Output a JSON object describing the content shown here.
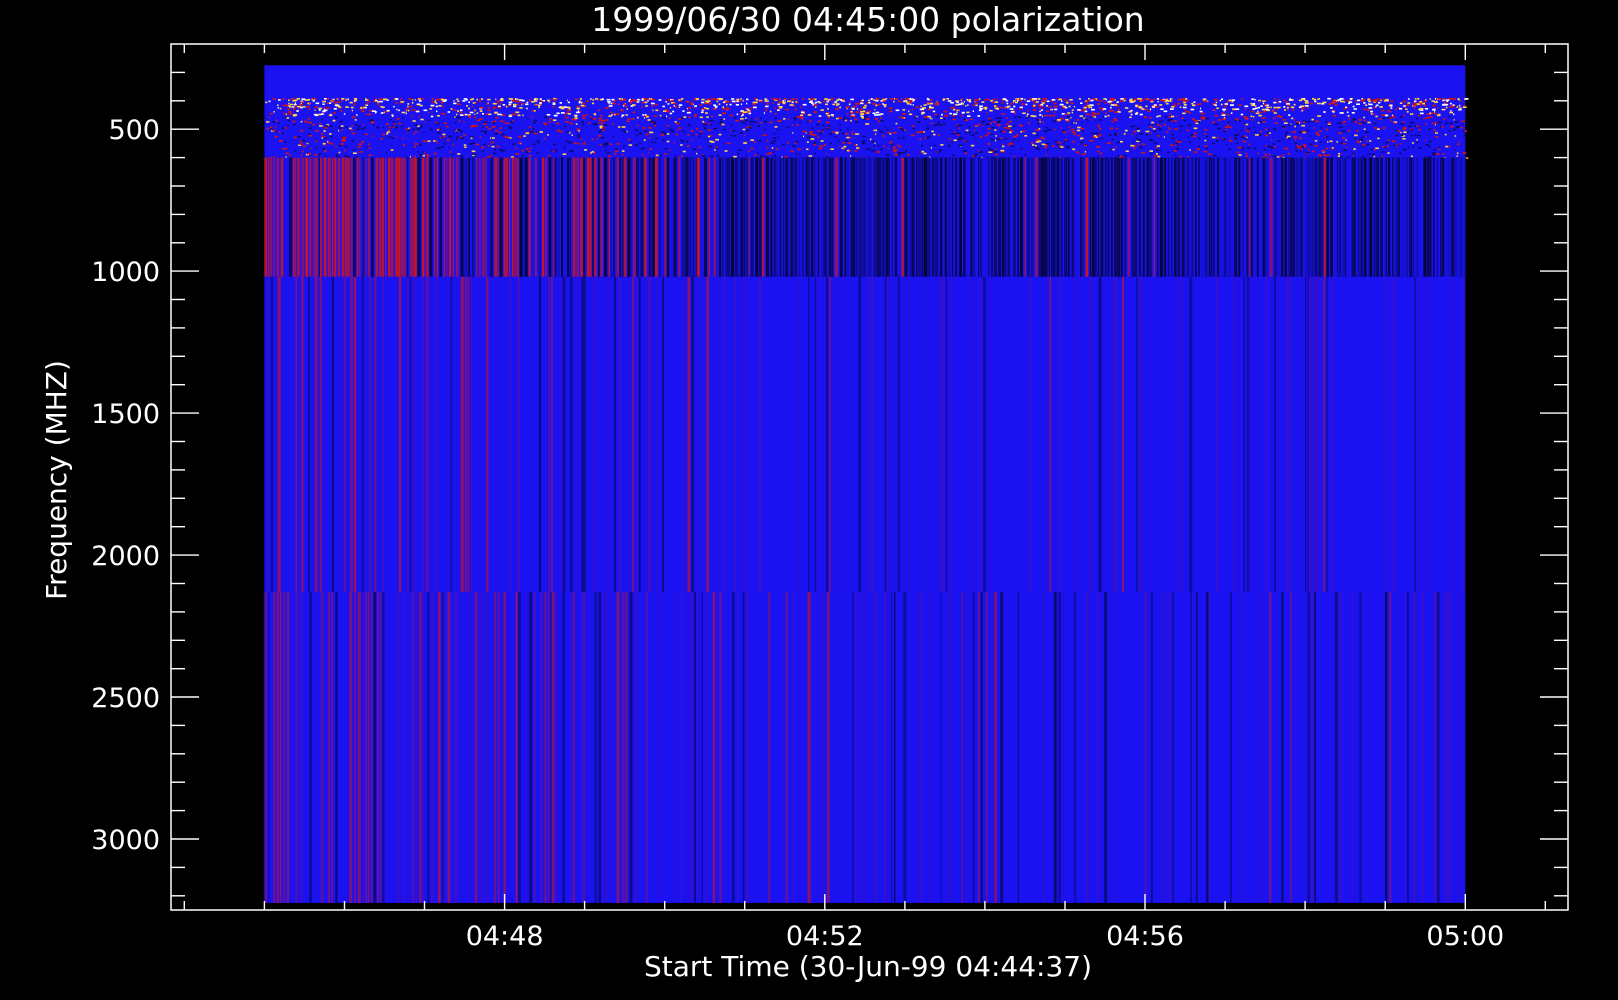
{
  "chart_data": {
    "type": "heatmap",
    "title": "1999/06/30 04:45:00 polarization",
    "xlabel": "Start Time (30-Jun-99 04:44:37)",
    "ylabel": "Frequency (MHZ)",
    "x_unit": "time (HH:MM, 30-Jun-1999)",
    "xlim": [
      "04:43:50",
      "05:01:17"
    ],
    "ylim": [
      3250,
      200
    ],
    "y_inverted": true,
    "data_time_range": [
      "04:45:00",
      "05:00:00"
    ],
    "data_freq_range": [
      275,
      3225
    ],
    "x_ticks": [
      "04:48",
      "04:52",
      "04:56",
      "05:00"
    ],
    "x_minor_ticks_per_major": 4,
    "y_ticks": [
      500,
      1000,
      1500,
      2000,
      2500,
      3000
    ],
    "y_minor_step": 100,
    "grid": false,
    "legend": "none",
    "colors": {
      "background": "#000000",
      "axes": "#ffffff",
      "text": "#ffffff",
      "low": "#0a0a6e",
      "mid": "#1a12f0",
      "high": "#d41414",
      "peak": "#ffd24a"
    },
    "bands": [
      {
        "name": "upper-uniform",
        "freq_range": [
          275,
          390
        ],
        "pattern": "uniform blue"
      },
      {
        "name": "noisy-speckle",
        "freq_range": [
          390,
          600
        ],
        "pattern": "speckled red/yellow/white noise on blue"
      },
      {
        "name": "low-band",
        "freq_range": [
          600,
          1020
        ],
        "pattern": "vertical stripes, red before ~04:51, dark blue after"
      },
      {
        "name": "mid-band",
        "freq_range": [
          1020,
          2130
        ],
        "pattern": "vertical stripes, mostly blue with faint red"
      },
      {
        "name": "high-band",
        "freq_range": [
          2130,
          3225
        ],
        "pattern": "vertical stripes, blue with red/purple"
      }
    ],
    "red_activity_profile": [
      {
        "time": "04:45",
        "level": 0.95
      },
      {
        "time": "04:46",
        "level": 0.9
      },
      {
        "time": "04:47",
        "level": 0.75
      },
      {
        "time": "04:48",
        "level": 0.6
      },
      {
        "time": "04:49",
        "level": 0.5
      },
      {
        "time": "04:50",
        "level": 0.42
      },
      {
        "time": "04:51",
        "level": 0.2
      },
      {
        "time": "04:52",
        "level": 0.12
      },
      {
        "time": "04:54",
        "level": 0.08
      },
      {
        "time": "04:56",
        "level": 0.06
      },
      {
        "time": "04:58",
        "level": 0.06
      },
      {
        "time": "05:00",
        "level": 0.05
      }
    ]
  }
}
